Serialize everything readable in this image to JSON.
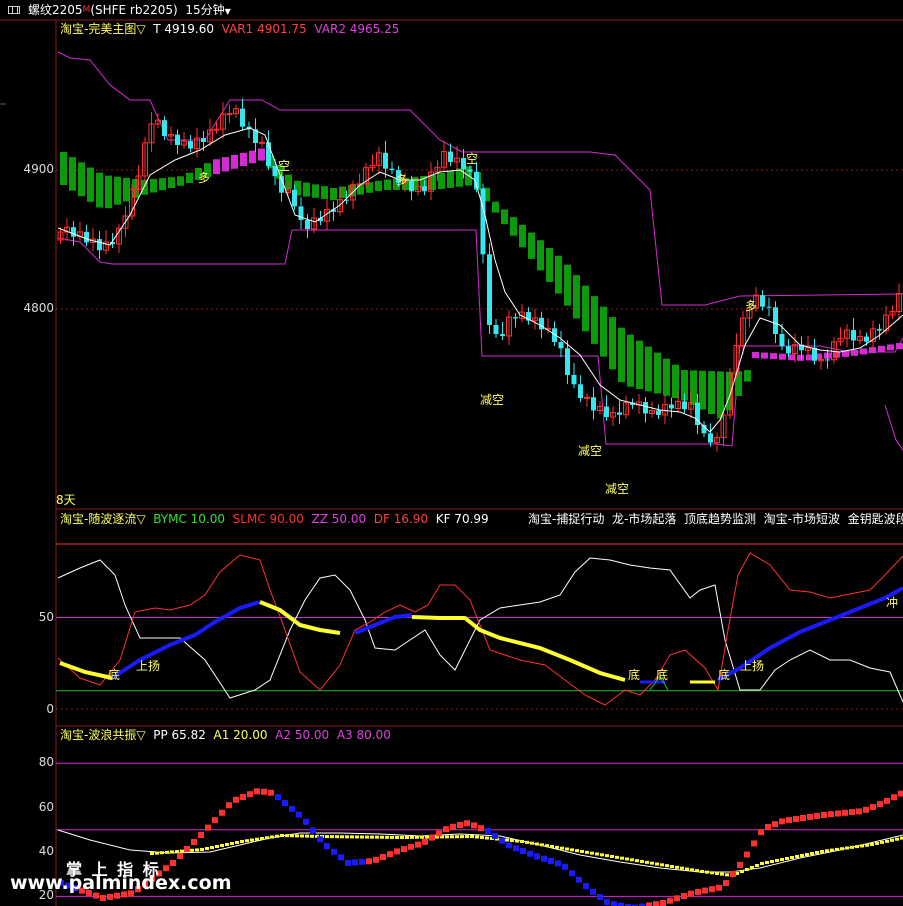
{
  "window": {
    "title": "螺纹2205",
    "flag": "M",
    "code": "(SHFE rb2205)",
    "period": "15分钟",
    "menu_caret": "▼"
  },
  "colors": {
    "bg": "#000000",
    "axis": "#8b1a1a",
    "up": "#ff3030",
    "down": "#35e8f0",
    "green": "#0a9a0a",
    "magenta": "#d62ad6",
    "yellow": "#ffff30",
    "blue": "#1a1aff",
    "white": "#ffffff"
  },
  "main": {
    "label": "淘宝-完美主图",
    "caret": "▽",
    "t": "T 4919.60",
    "var1": "VAR1 4901.75",
    "var2": "VAR2 4965.25",
    "y_ticks": [
      "4900",
      "4800"
    ],
    "day_label": "8天",
    "annotations": [
      "多",
      "空",
      "多",
      "空",
      "减空",
      "多",
      "减空",
      "减空"
    ]
  },
  "sub1": {
    "label": "淘宝-随波逐流",
    "caret": "▽",
    "bymc": "BYMC 10.00",
    "slmc": "SLMC 90.00",
    "zz": "ZZ 50.00",
    "df": "DF 16.90",
    "kf": "KF 70.99",
    "links": [
      "淘宝-捕捉行动",
      "龙-市场起落",
      "顶底趋势监测",
      "淘宝-市场短波",
      "金钥匙波段"
    ],
    "y_ticks": [
      "50",
      "0"
    ],
    "annotations": [
      "底",
      "上扬",
      "底",
      "底",
      "底",
      "上扬",
      "冲"
    ]
  },
  "sub2": {
    "label": "淘宝-波浪共振",
    "caret": "▽",
    "pp": "PP 65.82",
    "a1": "A1 20.00",
    "a2": "A2 50.00",
    "a3": "A3 80.00",
    "y_ticks": [
      "80",
      "60",
      "40",
      "20"
    ]
  },
  "watermark": {
    "cn": "掌 上 指 标",
    "url": "www.palmindex.com"
  },
  "chart_data": [
    {
      "type": "candlestick",
      "title": "淘宝-完美主图",
      "series": [
        {
          "name": "T",
          "last": 4919.6
        },
        {
          "name": "VAR1",
          "last": 4901.75
        },
        {
          "name": "VAR2",
          "last": 4965.25
        }
      ],
      "y_ticks": [
        4900,
        4800
      ],
      "ylim": [
        4700,
        4990
      ]
    },
    {
      "type": "line",
      "title": "淘宝-随波逐流",
      "series": [
        {
          "name": "BYMC",
          "last": 10.0
        },
        {
          "name": "SLMC",
          "last": 90.0
        },
        {
          "name": "ZZ",
          "last": 50.0
        },
        {
          "name": "DF",
          "last": 16.9
        },
        {
          "name": "KF",
          "last": 70.99
        }
      ],
      "y_ticks": [
        50,
        0
      ],
      "ylim": [
        -5,
        105
      ]
    },
    {
      "type": "line",
      "title": "淘宝-波浪共振",
      "series": [
        {
          "name": "PP",
          "last": 65.82
        },
        {
          "name": "A1",
          "last": 20.0
        },
        {
          "name": "A2",
          "last": 50.0
        },
        {
          "name": "A3",
          "last": 80.0
        }
      ],
      "y_ticks": [
        80,
        60,
        40,
        20
      ],
      "ylim": [
        20,
        85
      ]
    }
  ]
}
